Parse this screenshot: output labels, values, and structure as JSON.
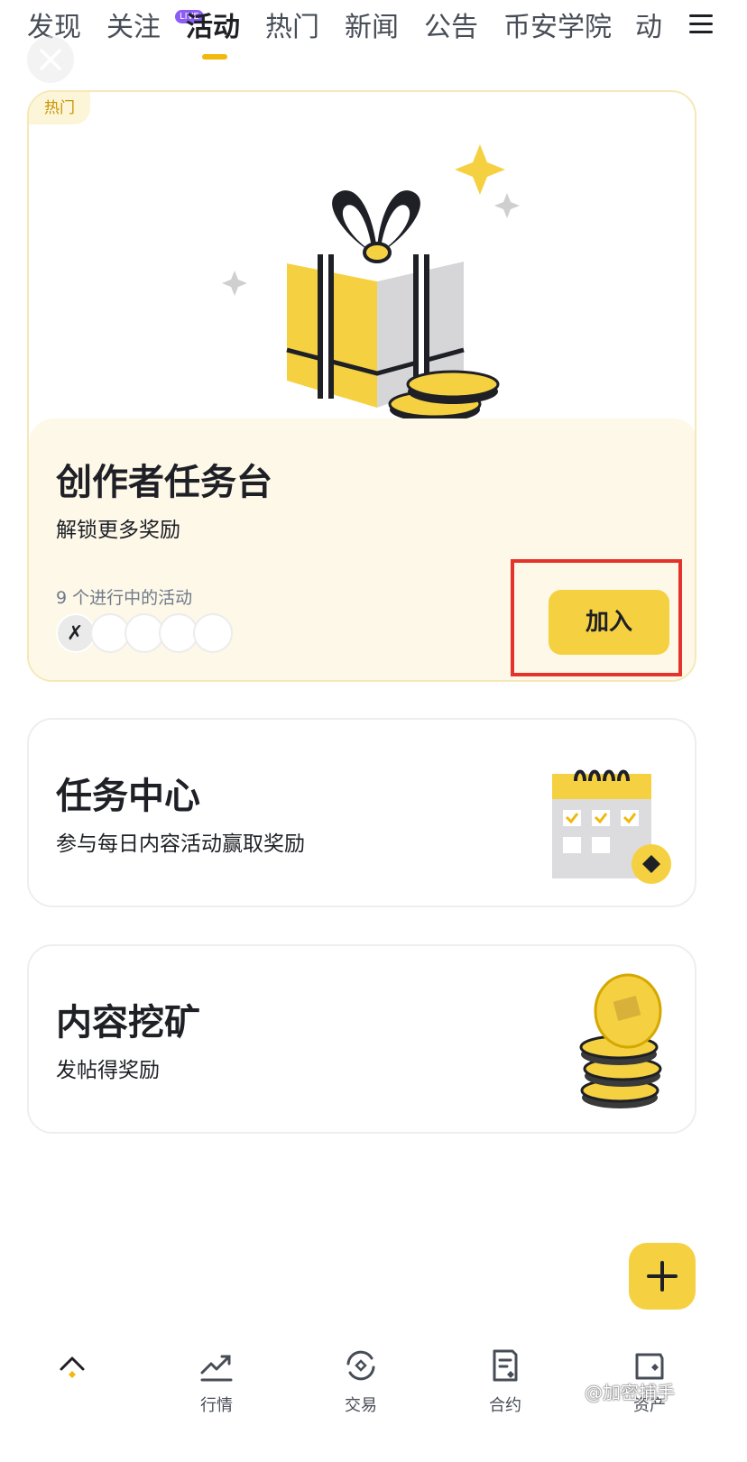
{
  "top_tabs": [
    {
      "label": "发现"
    },
    {
      "label": "关注",
      "badge": "LIVE"
    },
    {
      "label": "活动",
      "active": true
    },
    {
      "label": "热门"
    },
    {
      "label": "新闻"
    },
    {
      "label": "公告"
    },
    {
      "label": "币安学院"
    },
    {
      "label": "动"
    }
  ],
  "hot_card": {
    "tag": "热门",
    "title": "创作者任务台",
    "subtitle": "解锁更多奖励",
    "activity_count": "9 个进行中的活动",
    "join_label": "加入"
  },
  "task_card": {
    "title": "任务中心",
    "subtitle": "参与每日内容活动赢取奖励"
  },
  "mining_card": {
    "title": "内容挖矿",
    "subtitle": "发帖得奖励"
  },
  "bottom_nav": [
    {
      "label": "",
      "icon": "home-icon"
    },
    {
      "label": "行情",
      "icon": "markets-icon"
    },
    {
      "label": "交易",
      "icon": "trade-icon"
    },
    {
      "label": "合约",
      "icon": "futures-icon"
    },
    {
      "label": "资产",
      "icon": "wallet-icon"
    }
  ],
  "watermark": "@加密捕手",
  "colors": {
    "accent": "#f5d142",
    "brand_yellow": "#f0b90b",
    "highlight_red": "#e3332a",
    "live_purple": "#8b5cf6"
  }
}
